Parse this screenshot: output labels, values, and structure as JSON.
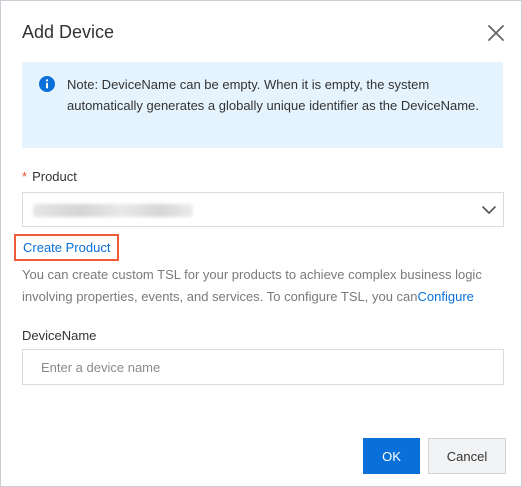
{
  "dialog": {
    "title": "Add Device",
    "close_icon": "close-icon"
  },
  "notice": {
    "icon": "info-icon",
    "text": "Note: DeviceName can be empty. When it is empty, the system automatically generates a globally unique identifier as the DeviceName."
  },
  "product": {
    "required_mark": "*",
    "label": "Product",
    "selected_value": "",
    "dropdown_icon": "chevron-down-icon"
  },
  "create_product": {
    "label": "Create Product"
  },
  "tsl_description": {
    "text": "You can create custom TSL for your products to achieve complex business logic involving properties, events, and services. To configure TSL, you can",
    "link_label": "Configure"
  },
  "device_name": {
    "label": "DeviceName",
    "value": "",
    "placeholder": "Enter a device name"
  },
  "footer": {
    "ok_label": "OK",
    "cancel_label": "Cancel"
  },
  "colors": {
    "primary": "#0a70d9",
    "notice_background": "#e5f3fe",
    "required": "#e84b36",
    "highlight_border": "#ef5a38"
  }
}
